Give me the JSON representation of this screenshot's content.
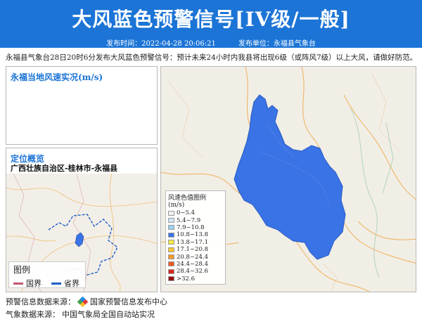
{
  "header": {
    "title": "大风蓝色预警信号[IV级/一般]",
    "publish_time": "发布时间：2022-04-28 20:06:21",
    "publisher": "发布单位：永福县气象台"
  },
  "notice": "永福县气象台28日20时6分发布大风蓝色预警信号：预计未来24小时内我县将出现6级（或阵风7级）以上大风，请做好防范。",
  "wind_panel": {
    "title": "永福当地风速实况(m/s)"
  },
  "location_panel": {
    "title": "定位概览",
    "region": "广西壮族自治区-桂林市-永福县",
    "legend_title": "图例",
    "legend_items": [
      {
        "label": "国界",
        "color": "#c2566e"
      },
      {
        "label": "省界",
        "color": "#1f5fc7"
      }
    ]
  },
  "map": {
    "area_color": "#3a73e6",
    "legend_title": "风速色值图例 (m/s)",
    "legend_items": [
      {
        "label": "0~5.4",
        "color": "#f1f1f1"
      },
      {
        "label": "5.4~7.9",
        "color": "#cfe6f7"
      },
      {
        "label": "7.9~10.8",
        "color": "#9dd0f2"
      },
      {
        "label": "10.8~13.8",
        "color": "#3a73e6"
      },
      {
        "label": "13.8~17.1",
        "color": "#f5e84a"
      },
      {
        "label": "17.1~20.8",
        "color": "#f7c534"
      },
      {
        "label": "20.8~24.4",
        "color": "#f49a2c"
      },
      {
        "label": "24.4~28.4",
        "color": "#ee5a1f"
      },
      {
        "label": "28.4~32.6",
        "color": "#d6261b"
      },
      {
        "label": ">32.6",
        "color": "#9b0d0d"
      }
    ]
  },
  "footer": {
    "warning_source_label": "预警信息数据来源：",
    "warning_source_value": "国家预警信息发布中心",
    "weather_source_label": "气象数据来源：",
    "weather_source_value": "中国气象局全国自动站实况"
  }
}
